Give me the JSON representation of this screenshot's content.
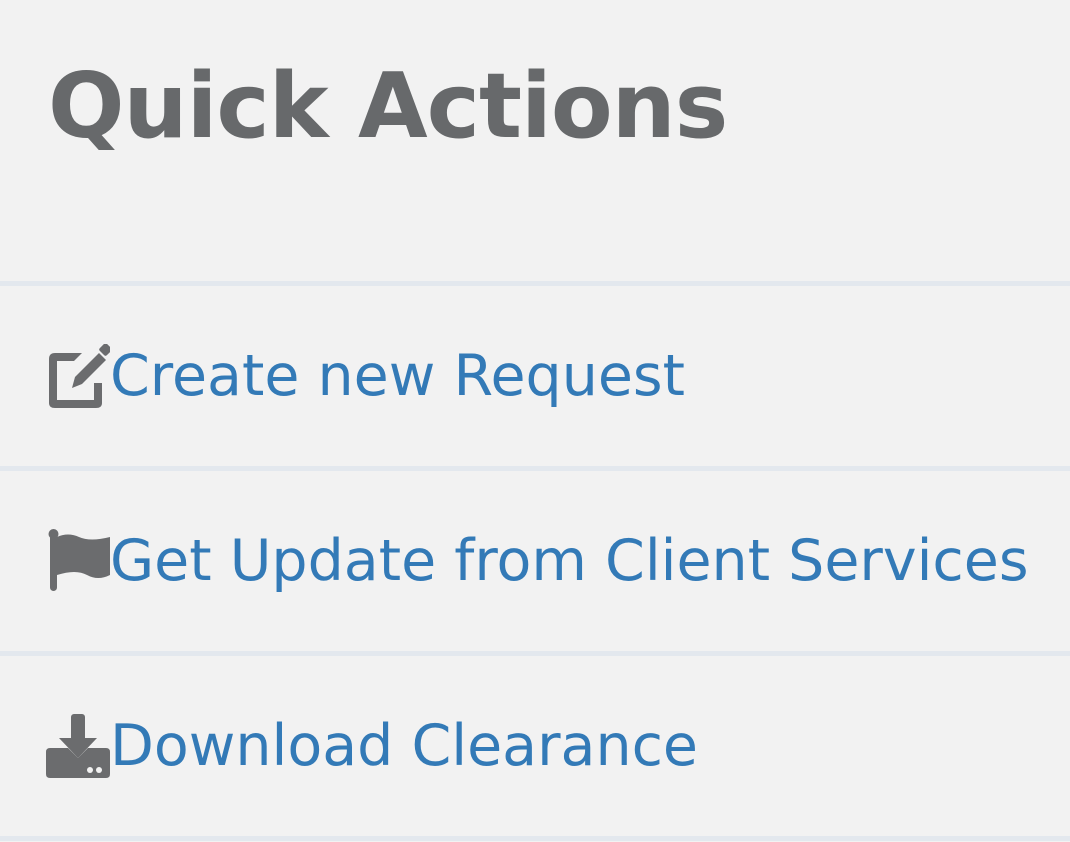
{
  "panel": {
    "title": "Quick Actions"
  },
  "actions": [
    {
      "label": "Create new Request",
      "icon": "edit-icon"
    },
    {
      "label": "Get Update from Client Services",
      "icon": "flag-icon"
    },
    {
      "label": "Download Clearance",
      "icon": "download-icon"
    }
  ],
  "colors": {
    "background": "#f2f2f2",
    "title": "#67696b",
    "link": "#337ab7",
    "icon": "#6b6c6e",
    "divider": "#e3e8ee"
  }
}
